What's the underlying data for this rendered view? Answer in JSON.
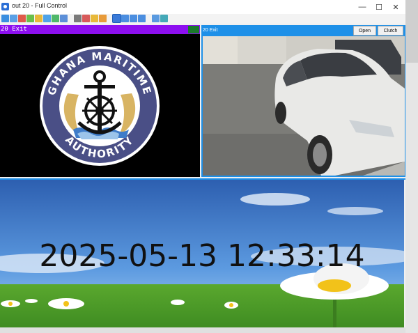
{
  "window": {
    "title": "out 20 - Full Control",
    "controls": {
      "minimize": "—",
      "maximize": "☐",
      "close": "✕"
    }
  },
  "toolbar": {
    "icons": [
      "monitor-icon",
      "camera-icon",
      "record-icon",
      "tag-icon",
      "folder-icon",
      "phone-icon",
      "ptz-icon",
      "chat-icon",
      "lock-icon",
      "alarm-icon",
      "folder2-icon",
      "save-icon",
      "layout-1-icon",
      "layout-4-icon",
      "layout-9-icon",
      "fullscreen-icon",
      "copy-icon",
      "settings-icon"
    ]
  },
  "left_panel": {
    "title": "20 Exit",
    "logo": {
      "top_text": "GHANA MARITIME",
      "bottom_text": "AUTHORITY"
    }
  },
  "right_panel": {
    "title": "20 Exit",
    "open_label": "Open",
    "clutch_label": "Clutch"
  },
  "bottom_panel": {
    "datetime": "2025-05-13 12:33:14"
  },
  "colors": {
    "header_purple": "#8d0ff0",
    "accent_blue": "#1e90e8"
  }
}
